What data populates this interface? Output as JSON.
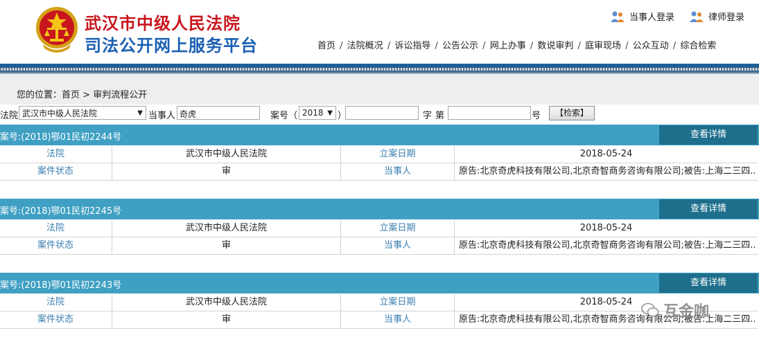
{
  "header": {
    "title_line1": "武汉市中级人民法院",
    "title_line2": "司法公开网上服务平台",
    "login_party": "当事人登录",
    "login_lawyer": "律师登录"
  },
  "nav": [
    "首页",
    "法院概况",
    "诉讼指导",
    "公告公示",
    "网上办事",
    "数说审判",
    "庭审现场",
    "公众互动",
    "综合检索"
  ],
  "breadcrumb": {
    "prefix": "您的位置：",
    "home": "首页",
    "sep": ">",
    "current": "审判流程公开"
  },
  "search": {
    "court_label": "法院",
    "court_value": "武汉市中级人民法院",
    "party_label": "当事人",
    "party_value": "奇虎",
    "case_label": "案号（",
    "year_value": "2018",
    "close_paren": "）",
    "zi_label": "字",
    "di_label": "第",
    "hao_label": "号",
    "search_button": "【检索】"
  },
  "cases": [
    {
      "title": "案号:(2018)鄂01民初2244号",
      "detail_button": "查看详情",
      "court_label": "法院",
      "court": "武汉市中级人民法院",
      "date_label": "立案日期",
      "date": "2018-05-24",
      "status_label": "案件状态",
      "status": "审",
      "party_label": "当事人",
      "party": "原告:北京奇虎科技有限公司,北京奇智商务咨询有限公司;被告:上海二三四..."
    },
    {
      "title": "案号:(2018)鄂01民初2245号",
      "detail_button": "查看详情",
      "court_label": "法院",
      "court": "武汉市中级人民法院",
      "date_label": "立案日期",
      "date": "2018-05-24",
      "status_label": "案件状态",
      "status": "审",
      "party_label": "当事人",
      "party": "原告:北京奇虎科技有限公司,北京奇智商务咨询有限公司;被告:上海二三四..."
    },
    {
      "title": "案号:(2018)鄂01民初2243号",
      "detail_button": "查看详情",
      "court_label": "法院",
      "court": "武汉市中级人民法院",
      "date_label": "立案日期",
      "date": "2018-05-24",
      "status_label": "案件状态",
      "status": "审",
      "party_label": "当事人",
      "party": "原告:北京奇虎科技有限公司,北京奇智商务咨询有限公司;被告:上海二三四..."
    }
  ],
  "watermark": "互金咖",
  "colors": {
    "title_red": "#c8161d",
    "title_blue": "#1a5fb4",
    "case_header": "#3fa0c3",
    "detail_button": "#1e6f8c",
    "label_blue": "#3a7fb0"
  }
}
